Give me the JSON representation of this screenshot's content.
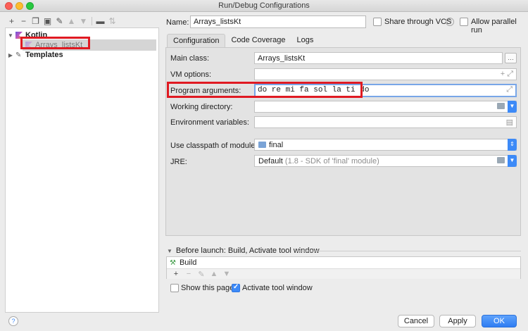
{
  "window": {
    "title": "Run/Debug Configurations"
  },
  "toolbar": {
    "icons": [
      "plus-icon",
      "minus-icon",
      "copy-icon",
      "save-icon",
      "wrench-icon",
      "up-arrow-icon",
      "down-arrow-icon",
      "folder-icon",
      "sort-icon"
    ]
  },
  "tree": {
    "kotlin_label": "Kotlin",
    "config_label": "Arrays_listsKt",
    "templates_label": "Templates"
  },
  "form": {
    "name_label": "Name:",
    "name_value": "Arrays_listsKt",
    "share_vcs": "Share through VCS",
    "help": "?",
    "allow_parallel": "Allow parallel run",
    "tabs": [
      "Configuration",
      "Code Coverage",
      "Logs"
    ],
    "main_class_label": "Main class:",
    "main_class_value": "Arrays_listsKt",
    "vm_options_label": "VM options:",
    "program_args_label": "Program arguments:",
    "program_args_value": "do re mi fa sol la ti do",
    "working_dir_label": "Working directory:",
    "env_vars_label": "Environment variables:",
    "classpath_label": "Use classpath of module:",
    "classpath_value": "final",
    "jre_label": "JRE:",
    "jre_value": "Default",
    "jre_detail": "(1.8 - SDK of 'final' module)"
  },
  "before_launch": {
    "header": "Before launch: Build, Activate tool window",
    "item": "Build",
    "show_page": "Show this page",
    "activate_tool": "Activate tool window"
  },
  "buttons": {
    "help": "?",
    "cancel": "Cancel",
    "apply": "Apply",
    "ok": "OK"
  },
  "colors": {
    "highlight_red": "#e01a22",
    "accent_blue": "#3d8af7"
  }
}
